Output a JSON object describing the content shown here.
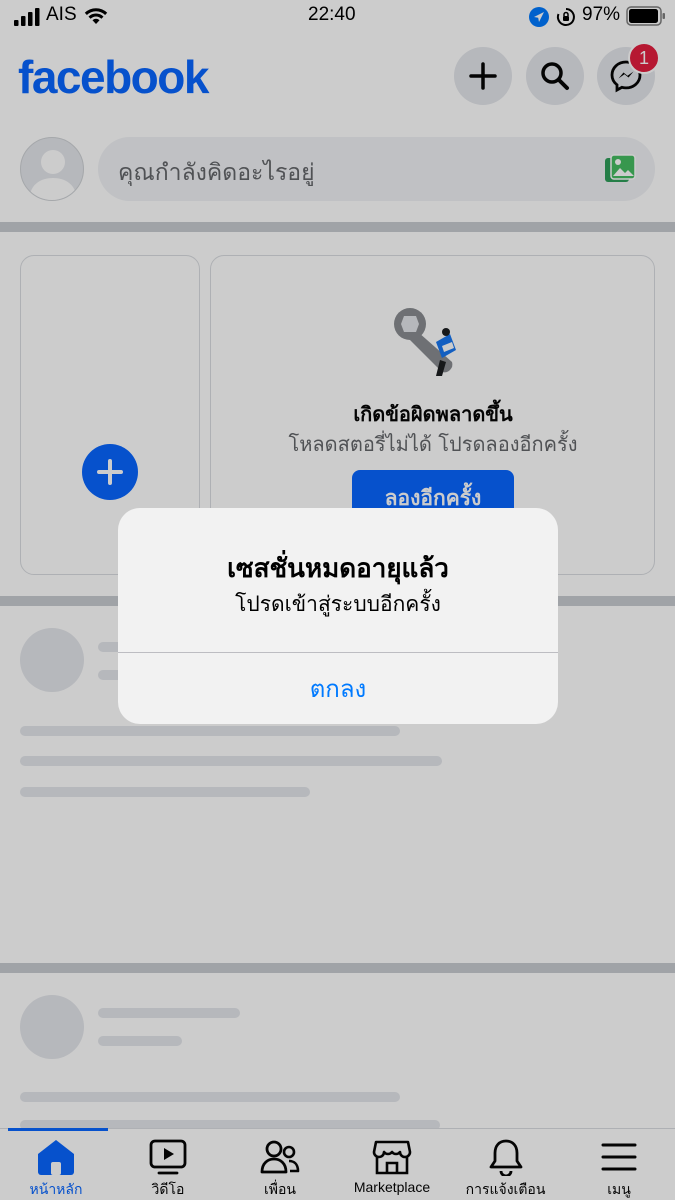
{
  "status_bar": {
    "carrier": "AIS",
    "time": "22:40",
    "battery": "97%"
  },
  "header": {
    "logo": "facebook",
    "messenger_badge": "1"
  },
  "composer": {
    "placeholder": "คุณกำลังคิดอะไรอยู่"
  },
  "stories": {
    "error_title": "เกิดข้อผิดพลาดขึ้น",
    "error_message": "โหลดสตอรี่ไม่ได้ โปรดลองอีกครั้ง",
    "retry_label": "ลองอีกครั้ง"
  },
  "dialog": {
    "title": "เซสชั่นหมดอายุแล้ว",
    "message": "โปรดเข้าสู่ระบบอีกครั้ง",
    "ok_label": "ตกลง"
  },
  "tabs": [
    {
      "label": "หน้าหลัก",
      "icon": "home-icon",
      "active": true
    },
    {
      "label": "วิดีโอ",
      "icon": "video-icon"
    },
    {
      "label": "เพื่อน",
      "icon": "friends-icon"
    },
    {
      "label": "Marketplace",
      "icon": "marketplace-icon"
    },
    {
      "label": "การแจ้งเตือน",
      "icon": "bell-icon"
    },
    {
      "label": "เมนู",
      "icon": "menu-icon"
    }
  ],
  "colors": {
    "brand": "#0866ff",
    "badge": "#e41e3f",
    "ios_link": "#007aff"
  }
}
